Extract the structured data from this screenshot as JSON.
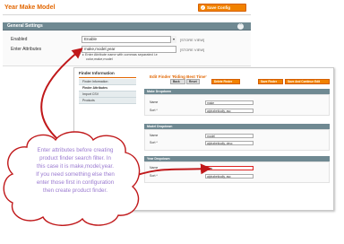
{
  "header": {
    "title": "Year Make Model",
    "save_button_label": "Save Config"
  },
  "general_settings": {
    "title": "General Settings",
    "rows": [
      {
        "label": "Enabled",
        "value": "Enable",
        "scope": "[STORE VIEW]"
      },
      {
        "label": "Enter Attributes",
        "value": "make,model,year",
        "scope": "[STORE VIEW]"
      }
    ],
    "note_line1": "Enter Attribute name with commas separated i.e",
    "note_line2": "color,make,model"
  },
  "finder": {
    "sidebar_title": "Finder Information",
    "sidebar_items": [
      "Finder Information",
      "Finder Attributes",
      "Import CSV",
      "Products"
    ],
    "page_title": "Edit Finder 'Riding Best Time'",
    "toolbar": {
      "back": "Back",
      "reset": "Reset",
      "delete": "Delete Finder",
      "save": "Save Finder",
      "save_continue": "Save And Continue Edit"
    },
    "sections": [
      {
        "title": "Make Dropdown",
        "name_label": "Name",
        "name_value": "make",
        "sort_label": "Sort *",
        "sort_value": "alphabetically, asc"
      },
      {
        "title": "Model Dropdown",
        "name_label": "Name",
        "name_value": "model",
        "sort_label": "Sort *",
        "sort_value": "alphabetically, desc"
      },
      {
        "title": "Year Dropdown",
        "name_label": "Name",
        "name_value": "year",
        "sort_label": "Sort *",
        "sort_value": "alphabetically, asc"
      }
    ]
  },
  "cloud_note": {
    "lines": [
      "Enter attributes before creating",
      "product finder search filter.  In",
      "this case it is make,model,year.",
      "If you need something else then",
      "enter those first in configuration",
      "then create product finder."
    ]
  },
  "colors": {
    "accent": "#e26703",
    "button": "#f18200",
    "section_bar": "#6f8992",
    "arrow": "#c0181a",
    "cloud_text": "#9a7ad0"
  }
}
